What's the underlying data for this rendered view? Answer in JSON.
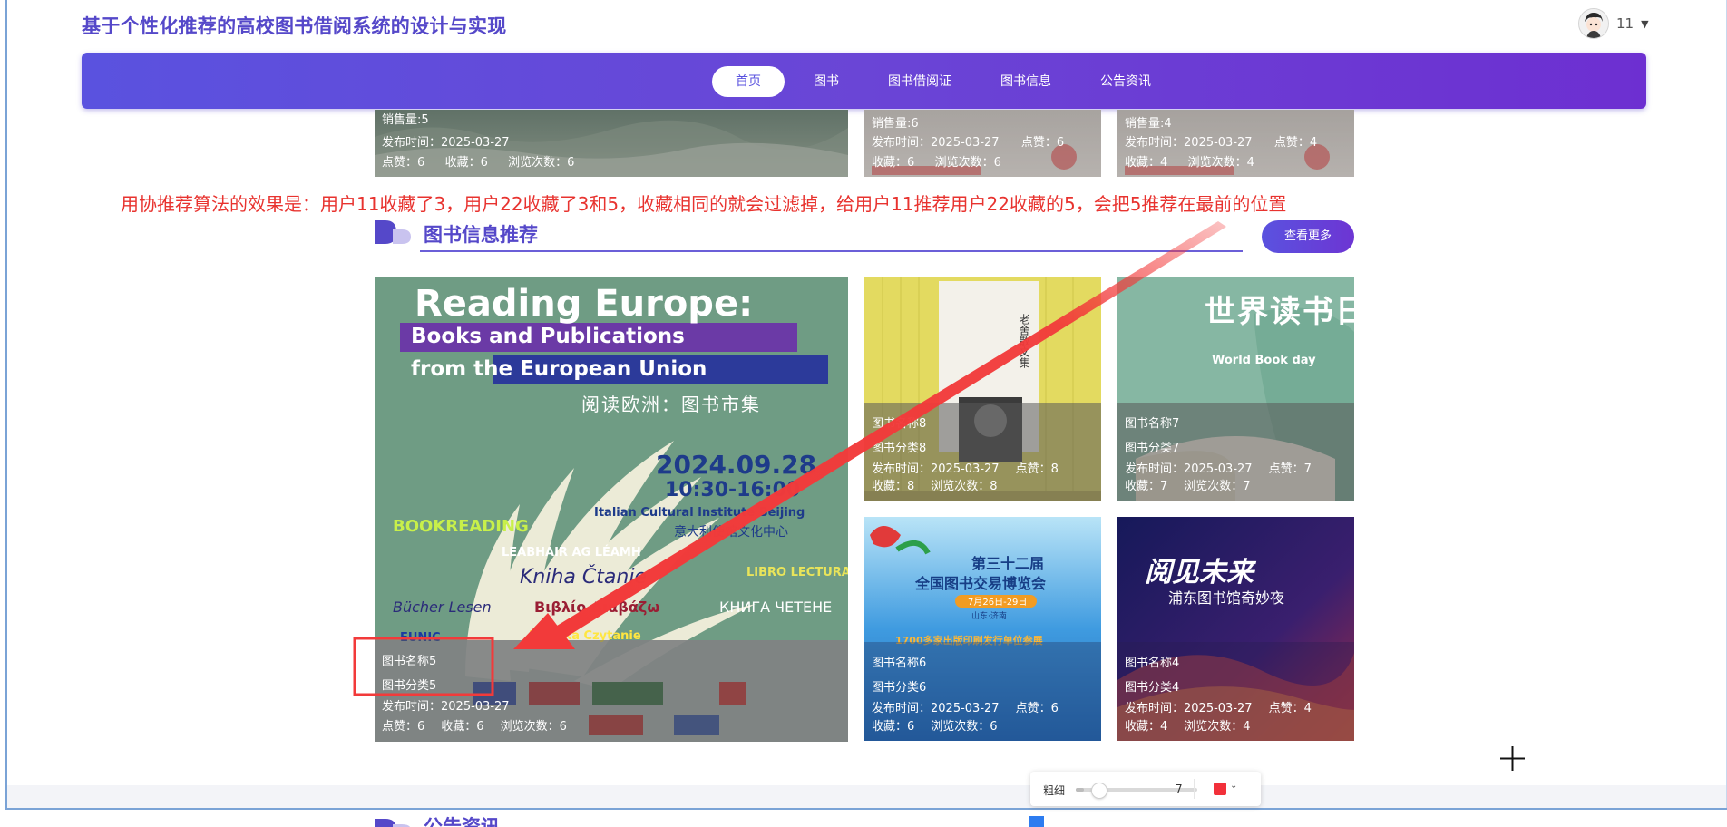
{
  "site": {
    "title": "基于个性化推荐的高校图书借阅系统的设计与实现"
  },
  "user": {
    "name": "11",
    "avatar_icon": "user-avatar-icon",
    "dropdown_icon": "caret-down-icon"
  },
  "nav": {
    "items": [
      {
        "label": "首页",
        "active": true
      },
      {
        "label": "图书",
        "active": false
      },
      {
        "label": "图书借阅证",
        "active": false
      },
      {
        "label": "图书信息",
        "active": false
      },
      {
        "label": "公告资讯",
        "active": false
      }
    ]
  },
  "top_strip": {
    "cards": [
      {
        "line1": "销售量:5",
        "line2": "发布时间：2025-03-27",
        "line3_likes": "点赞：6",
        "line3_fav": "收藏：6",
        "line3_views": "浏览次数：6"
      },
      {
        "line1": "销售量:6",
        "line2_date": "发布时间：2025-03-27",
        "line2_likes": "点赞：6",
        "line3_fav": "收藏：6",
        "line3_views": "浏览次数：6"
      },
      {
        "line1": "销售量:4",
        "line2_date": "发布时间：2025-03-27",
        "line2_likes": "点赞：4",
        "line3_fav": "收藏：4",
        "line3_views": "浏览次数：4"
      }
    ]
  },
  "annotation": {
    "text": "用协推荐算法的效果是：用户11收藏了3，用户22收藏了3和5，收藏相同的就会过滤掉，给用户11推荐用户22收藏的5，会把5推荐在最前的位置",
    "color": "#e8332f"
  },
  "recommend_section": {
    "title": "图书信息推荐",
    "more_label": "查看更多",
    "cards": [
      {
        "name": "图书名称5",
        "category": "图书分类5",
        "date": "发布时间：2025-03-27",
        "likes": "点赞：6",
        "favorites": "收藏：6",
        "views": "浏览次数：6",
        "cover": {
          "heading1": "Reading Europe:",
          "heading2": "Books and Publications",
          "heading3": "from the European Union",
          "subtitle_cn": "阅读欧洲：图书市集",
          "date_text": "2024.09.28",
          "time_text": "10:30-16:00",
          "venue_en": "Italian Cultural Institute Beijing",
          "venue_cn": "意大利使馆文化中心",
          "words": [
            "BOOKREADING",
            "LEABHAIR AG LÉAMH",
            "Kniha Čtanie",
            "LIBRO LECTURA",
            "Bücher Lesen",
            "Βιβλίο Διαβάζω",
            "КНИГА ЧЕТЕНЕ",
            "Książka Czytanie",
            "EUNIC"
          ]
        }
      },
      {
        "name": "图书名称8",
        "category": "图书分类8",
        "date": "发布时间：2025-03-27",
        "likes": "点赞：8",
        "favorites": "收藏：8",
        "views": "浏览次数：8",
        "cover": {
          "spine_text": "老舍散文集"
        }
      },
      {
        "name": "图书名称7",
        "category": "图书分类7",
        "date": "发布时间：2025-03-27",
        "likes": "点赞：7",
        "favorites": "收藏：7",
        "views": "浏览次数：7",
        "cover": {
          "title_cn": "世界读书日",
          "title_en": "World Book day"
        }
      },
      {
        "name": "图书名称6",
        "category": "图书分类6",
        "date": "发布时间：2025-03-27",
        "likes": "点赞：6",
        "favorites": "收藏：6",
        "views": "浏览次数：6",
        "cover": {
          "line1": "第三十二届",
          "line2": "全国图书交易博览会",
          "line3": "7月26日-29日",
          "line4": "山东·济南",
          "line5": "1700多家出版印刷发行单位参展"
        }
      },
      {
        "name": "图书名称4",
        "category": "图书分类4",
        "date": "发布时间：2025-03-27",
        "likes": "点赞：4",
        "favorites": "收藏：4",
        "views": "浏览次数：4",
        "cover": {
          "title": "阅见未来",
          "subtitle": "浦东图书馆奇妙夜"
        }
      }
    ]
  },
  "next_section": {
    "title": "公告资讯"
  },
  "draw_toolbar": {
    "label": "粗细",
    "value": "7",
    "value_fraction": 0.07,
    "color": "#f2303a"
  }
}
